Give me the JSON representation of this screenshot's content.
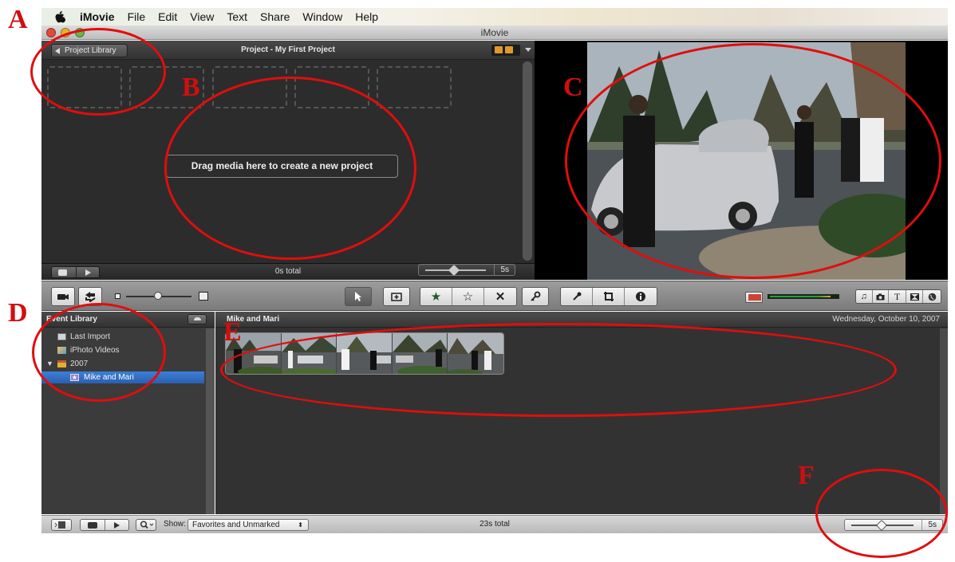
{
  "menubar": {
    "app_name": "iMovie",
    "items": [
      "File",
      "Edit",
      "View",
      "Text",
      "Share",
      "Window",
      "Help"
    ]
  },
  "window": {
    "title": "iMovie"
  },
  "project_pane": {
    "library_button": "Project Library",
    "title": "Project - My First Project",
    "drop_hint": "Drag media here to create a new project",
    "total": "0s total",
    "zoom_value": "5s"
  },
  "event_library": {
    "header": "Event Library",
    "items": [
      {
        "label": "Last Import",
        "icon": "last-import-icon"
      },
      {
        "label": "iPhoto Videos",
        "icon": "iphoto-icon"
      },
      {
        "label": "2007",
        "icon": "calendar-icon"
      },
      {
        "label": "Mike and Mari",
        "icon": "event-star-icon",
        "selected": true
      }
    ]
  },
  "event_browser": {
    "event_name": "Mike and Mari",
    "date": "Wednesday, October 10, 2007"
  },
  "bottom_bar": {
    "show_label": "Show:",
    "show_value": "Favorites and Unmarked",
    "total": "23s total",
    "zoom_value": "5s"
  },
  "annotations": {
    "letters": [
      "A",
      "B",
      "C",
      "D",
      "E",
      "F"
    ],
    "color": "#e10d0d"
  },
  "colors": {
    "selection": "#2f68c4",
    "pane_background": "#2c2c2c"
  }
}
